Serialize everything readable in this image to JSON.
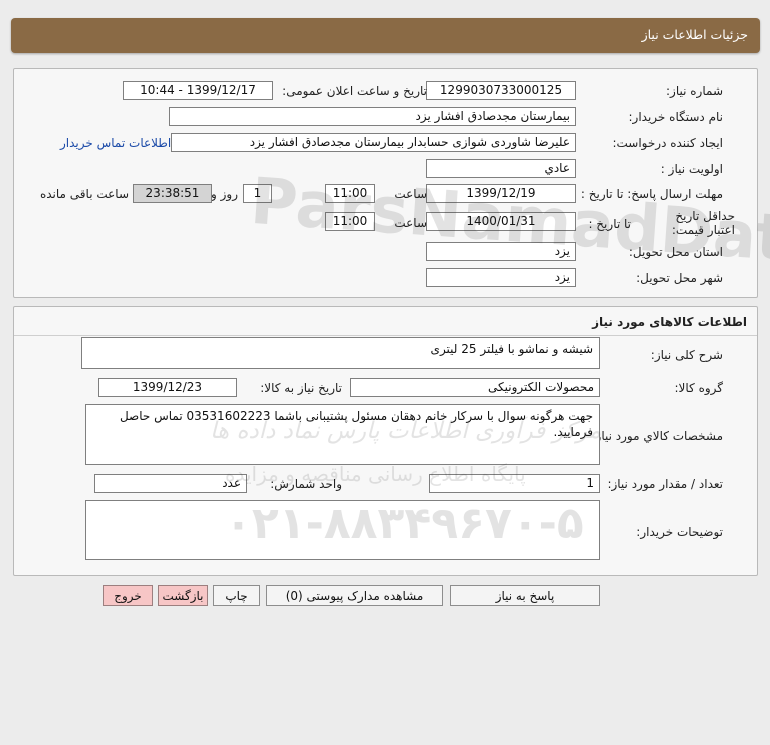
{
  "header": {
    "title": "جزئیات اطلاعات نیاز"
  },
  "info": {
    "need_number_label": "شماره نیاز:",
    "need_number": "1299030733000125",
    "announce_label": "تاریخ و ساعت اعلان عمومی:",
    "announce_value": "1399/12/17 - 10:44",
    "buyer_label": "نام دستگاه خریدار:",
    "buyer": "بیمارستان مجدصادق افشار یزد",
    "creator_label": "ایجاد کننده درخواست:",
    "creator": "علیرضا شاوردی شوازی حسابدار بیمارستان مجدصادق افشار یزد",
    "contact_link": "اطلاعات تماس خریدار",
    "priority_label": "اولویت نیاز :",
    "priority": "عادي",
    "deadline_label": "مهلت ارسال پاسخ: تا تاریخ :",
    "deadline_date": "1399/12/19",
    "time_label": "ساعت",
    "deadline_time": "11:00",
    "days_value": "1",
    "days_label": "روز و",
    "remaining": "23:38:51",
    "remaining_label": "ساعت باقی مانده",
    "validity_label": "حداقل تاریخ اعتبار قیمت:",
    "validity_to_label": "تا تاریخ :",
    "validity_date": "1400/01/31",
    "validity_time": "11:00",
    "province_label": "استان محل تحویل:",
    "province": "یزد",
    "city_label": "شهر محل تحویل:",
    "city": "یزد"
  },
  "goods": {
    "section_title": "اطلاعات کالاهای مورد نیاز",
    "summary_label": "شرح کلی نیاز:",
    "summary": "شیشه و نماشو با فیلتر 25 لیتری",
    "group_label": "گروه کالا:",
    "group": "محصولات الکترونیکی",
    "need_date_label": "تاریخ نیاز به کالا:",
    "need_date": "1399/12/23",
    "specs_label": "مشخصات کالاي مورد نياز:",
    "specs": "جهت هرگونه سوال با سرکار خانم دهقان مسئول پشتیبانی باشما 03531602223 تماس حاصل فرمایید.",
    "qty_label": "تعداد / مقدار مورد نیاز:",
    "qty": "1",
    "unit_label": "واحد شمارش:",
    "unit": "عدد",
    "notes_label": "توضیحات خریدار:",
    "notes": ""
  },
  "buttons": {
    "reply": "پاسخ به نیاز",
    "attachments": "مشاهده مدارک پیوستی (0)",
    "print": "چاپ",
    "back": "بازگشت",
    "exit": "خروج"
  },
  "watermark": {
    "line1": "مرکز فرآوری اطلاعات پارس نماد داده ها",
    "line2": "پایگاه اطلاع رسانی مناقصه و مزایده",
    "phone": "۰۲۱-۸۸۳۴۹۶۷۰-۵",
    "brand": "ParsNamadData"
  }
}
